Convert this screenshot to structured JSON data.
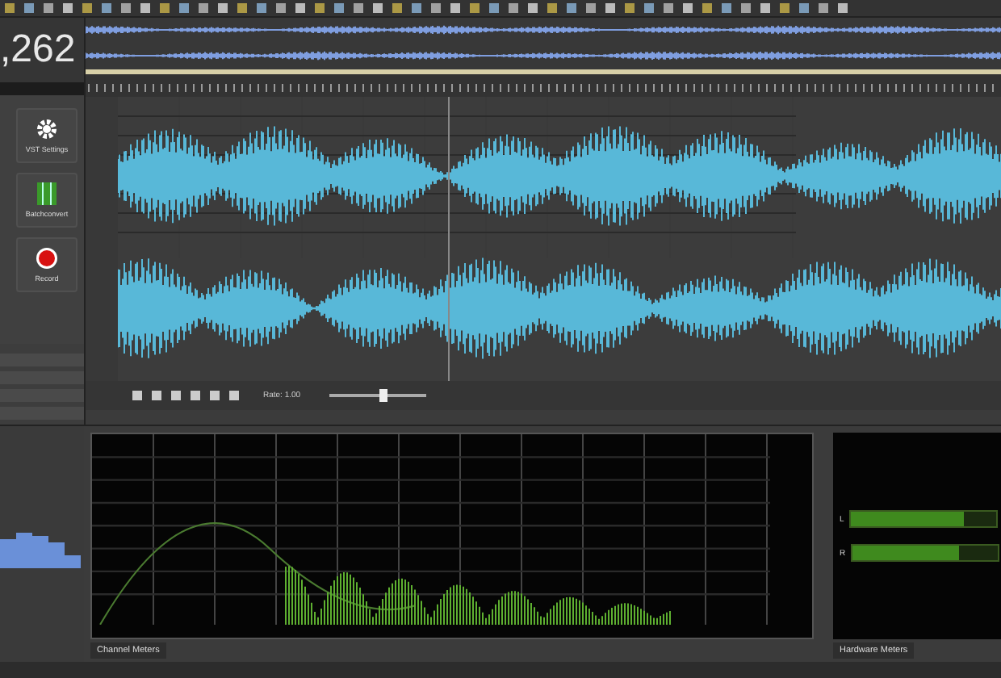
{
  "counter": ",262",
  "tool_buttons": [
    {
      "label": "VST Settings",
      "kind": "settings"
    },
    {
      "label": "Batchconvert",
      "kind": "convert"
    },
    {
      "label": "Record",
      "kind": "record"
    }
  ],
  "transport": {
    "rate_label": "Rate: 1.00",
    "rate_slider": {
      "level": 0.55
    }
  },
  "panels": [
    {
      "tab": "Channel Meters"
    },
    {
      "tab": "Hardware Meters"
    }
  ],
  "meters": [
    {
      "channel": "L",
      "level": 0.78
    },
    {
      "channel": "R",
      "level": 0.74
    }
  ]
}
